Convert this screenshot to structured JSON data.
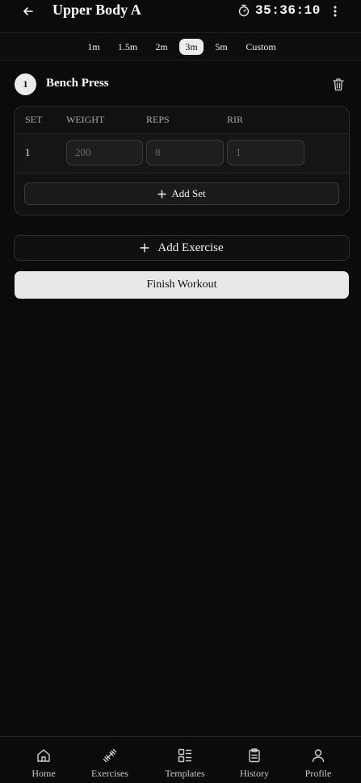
{
  "header": {
    "title": "Upper Body A",
    "timer": "35:36:10",
    "back_icon": "arrow-left-icon",
    "timer_icon": "stopwatch-icon",
    "more_icon": "more-vertical-icon"
  },
  "rest_timer": {
    "options": [
      "1m",
      "1.5m",
      "2m",
      "3m",
      "5m",
      "Custom"
    ],
    "selected": "3m"
  },
  "exercise": {
    "number": "1",
    "name": "Bench Press",
    "columns": {
      "set": "SET",
      "weight": "WEIGHT",
      "reps": "REPS",
      "rir": "RIR"
    },
    "sets": [
      {
        "set": "1",
        "weight_placeholder": "200",
        "reps_placeholder": "8",
        "rir_placeholder": "1"
      }
    ],
    "add_set_label": "Add Set"
  },
  "actions": {
    "add_exercise_label": "Add Exercise",
    "finish_label": "Finish Workout"
  },
  "nav": {
    "items": [
      {
        "label": "Home",
        "icon": "home-icon"
      },
      {
        "label": "Exercises",
        "icon": "dumbbell-icon"
      },
      {
        "label": "Templates",
        "icon": "layout-list-icon"
      },
      {
        "label": "History",
        "icon": "clipboard-icon"
      },
      {
        "label": "Profile",
        "icon": "user-icon"
      }
    ]
  },
  "colors": {
    "background": "#0b0b0b",
    "accent": "#ececec",
    "card": "#111111"
  }
}
